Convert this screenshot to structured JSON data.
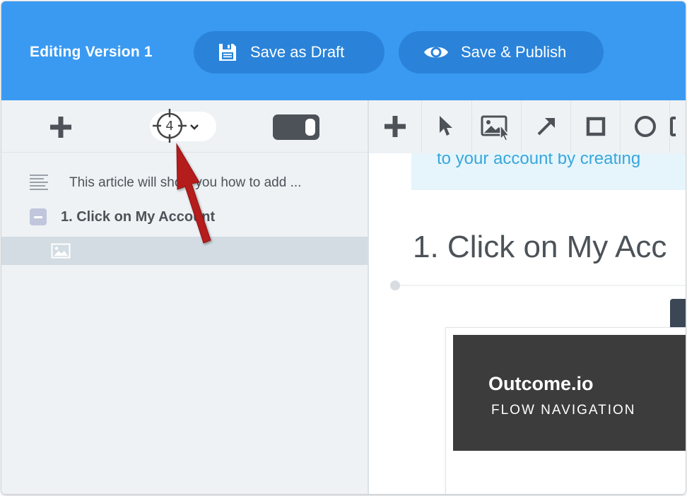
{
  "header": {
    "title": "Editing Version 1",
    "save_draft_label": "Save as Draft",
    "save_publish_label": "Save & Publish",
    "background_color": "#3a9af2",
    "pill_color": "#2a83d9"
  },
  "toolbar": {
    "add_step_icon": "plus-icon",
    "step_number": "4",
    "step_picker_icon": "crosshair-icon",
    "toggle_icon": "toggle-icon",
    "tools": [
      "plus-icon",
      "cursor-icon",
      "image-cursor-icon",
      "arrow-icon",
      "square-icon",
      "circle-icon"
    ]
  },
  "tree": {
    "intro_text": "This article will show you how to add ...",
    "step_label": "1.  Click on My Account",
    "image_item_icon": "image-icon",
    "selected_row_color": "#d3dce3"
  },
  "content": {
    "callout_text": "to your account by creating",
    "heading": "1.  Click on My Acc",
    "screenshot": {
      "brand": "Outcome.io",
      "subtitle": "FLOW NAVIGATION"
    }
  },
  "annotation": {
    "arrow_color": "#b51c1f"
  }
}
